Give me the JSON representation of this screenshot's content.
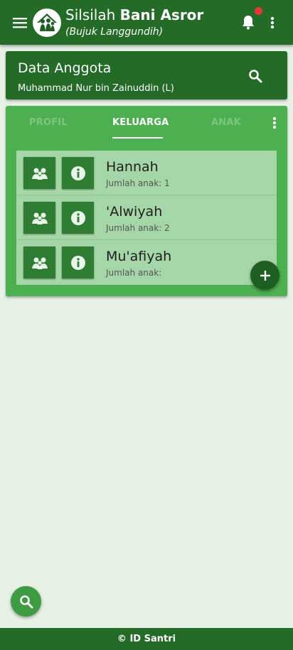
{
  "header": {
    "title_prefix": "Silsilah ",
    "title_bold": "Bani Asror",
    "subtitle": "(Bujuk Langgundih)",
    "icons": {
      "menu": "hamburger-icon",
      "logo": "family-home-logo",
      "notifications": "bell-icon",
      "more": "more-vertical-icon"
    },
    "notification_dot_color": "#e53935"
  },
  "data_card": {
    "title": "Data Anggota",
    "member": "Muhammad Nur bin Zainuddin (L)",
    "search_icon": "search-icon"
  },
  "tabs": [
    {
      "label": "PROFIL",
      "active": false
    },
    {
      "label": "KELUARGA",
      "active": true
    },
    {
      "label": "ANAK",
      "active": false
    }
  ],
  "family_list": [
    {
      "name": "Hannah",
      "children_label": "Jumlah anak: 1"
    },
    {
      "name": "'Alwiyah",
      "children_label": "Jumlah anak: 2"
    },
    {
      "name": "Mu'afiyah",
      "children_label": "Jumlah anak:"
    }
  ],
  "list_icons": {
    "family": "family-icon",
    "info": "info-icon"
  },
  "fab": {
    "add_icon": "plus-icon",
    "search_icon": "search-icon"
  },
  "footer": {
    "text": "© ID Santri"
  },
  "colors": {
    "primary": "#236b26",
    "panel": "#4caf50",
    "list_bg": "#a5d6a7",
    "background": "#e6f0e5"
  }
}
